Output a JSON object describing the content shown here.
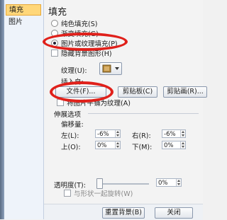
{
  "sidebar": {
    "items": [
      {
        "label": "填充"
      },
      {
        "label": "图片"
      }
    ]
  },
  "panel": {
    "title": "填充",
    "options": [
      {
        "label": "纯色填充(S)",
        "checked": false
      },
      {
        "label": "渐变填充(G)",
        "checked": false
      },
      {
        "label": "图片或纹理填充(P)",
        "checked": true
      }
    ],
    "hide_bg": "隐藏背景图形(H)",
    "texture_label": "纹理(U):",
    "insert_from": "插入自:",
    "buttons": {
      "file": "文件(F)...",
      "clipboard": "剪贴板(C)",
      "clipart": "剪贴画(R)..."
    },
    "tile_label": "将图片平铺为纹理(A)",
    "stretch_label": "伸展选项",
    "offsets_label": "偏移量:",
    "left_label": "左(L):",
    "left_val": "-6%",
    "right_label": "右(R):",
    "right_val": "-6%",
    "top_label": "上(O):",
    "top_val": "0%",
    "bottom_label": "下(M):",
    "bottom_val": "0%",
    "transparency_label": "透明度(T):",
    "transparency_val": "0%",
    "transparency_level": 0,
    "rotate_label": "与形状一起旋转(W)"
  },
  "footer": {
    "reset": "重置背景(B)",
    "close": "关闭"
  },
  "colors": {
    "selection": "#ffd77a",
    "annotation": "#e0201a"
  }
}
